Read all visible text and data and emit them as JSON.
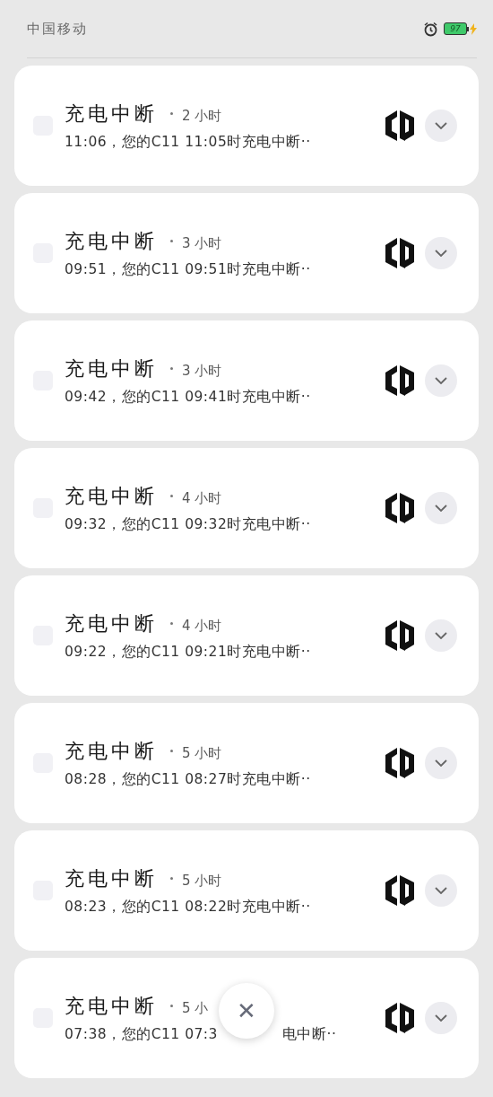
{
  "status_bar": {
    "carrier": "中国移动",
    "battery": "97"
  },
  "notifications": [
    {
      "checked": false,
      "title": "充电中断",
      "time": "2 小时",
      "body": "11:06，您的C11 11:05时充电中断··"
    },
    {
      "checked": false,
      "title": "充电中断",
      "time": "3 小时",
      "body": "09:51，您的C11 09:51时充电中断··"
    },
    {
      "checked": false,
      "title": "充电中断",
      "time": "3 小时",
      "body": "09:42，您的C11 09:41时充电中断··"
    },
    {
      "checked": false,
      "title": "充电中断",
      "time": "4 小时",
      "body": "09:32，您的C11 09:32时充电中断··"
    },
    {
      "checked": false,
      "title": "充电中断",
      "time": "4 小时",
      "body": "09:22，您的C11 09:21时充电中断··"
    },
    {
      "checked": false,
      "title": "充电中断",
      "time": "5 小时",
      "body": "08:28，您的C11 08:27时充电中断··"
    },
    {
      "checked": false,
      "title": "充电中断",
      "time": "5 小时",
      "body": "08:23，您的C11 08:22时充电中断··"
    },
    {
      "checked": false,
      "title": "充电中断",
      "time": "5 小",
      "body": "07:38，您的C11 07:3",
      "body_tail": "电中断··"
    }
  ],
  "close_button": {
    "label": "✕"
  }
}
